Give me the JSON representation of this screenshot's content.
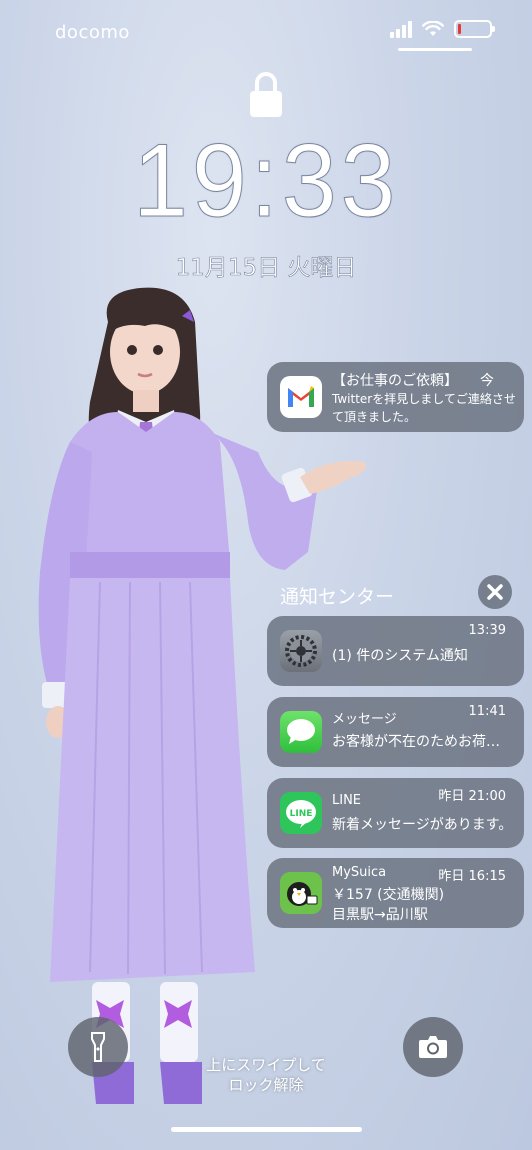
{
  "status_bar": {
    "carrier": "docomo",
    "signal_icon": "signal-bars-icon",
    "wifi_icon": "wifi-icon",
    "battery_icon": "battery-icon",
    "battery_level": 0.08,
    "battery_color": "#e53a34"
  },
  "lock_screen": {
    "lock_icon": "lock-icon",
    "time": "19:33",
    "date": "11月15日 火曜日"
  },
  "notifications": {
    "top": {
      "app_icon": "gmail-icon",
      "title": "【お仕事のご依頼】",
      "time": "今",
      "body_line1": "Twitterを拝見しましてご連絡させ",
      "body_line2": "て頂きました。"
    },
    "center": {
      "header": "通知センター",
      "close_icon": "close-icon",
      "items": [
        {
          "app_icon": "settings-gear-icon",
          "title": "",
          "time": "13:39",
          "body": "(1) 件のシステム通知"
        },
        {
          "app_icon": "messages-icon",
          "title": "メッセージ",
          "time": "11:41",
          "body": "お客様が不在のためお荷物を持ち帰りました"
        },
        {
          "app_icon": "line-icon",
          "title": "LINE",
          "time": "昨日 21:00",
          "body": "新着メッセージがあります。"
        },
        {
          "app_icon": "suica-penguin-icon",
          "title": "MySuica",
          "time": "昨日 16:15",
          "body": "￥157 (交通機関)",
          "body_line2": "目黒駅→品川駅"
        }
      ]
    }
  },
  "bottom": {
    "flashlight_icon": "flashlight-icon",
    "camera_icon": "camera-icon",
    "swipe_hint_line1": "上にスワイプして",
    "swipe_hint_line2": "ロック解除"
  },
  "colors": {
    "notification_bg": "#6e7684",
    "wallpaper": "#c9d3e6",
    "dress": "#b9a6e6"
  }
}
